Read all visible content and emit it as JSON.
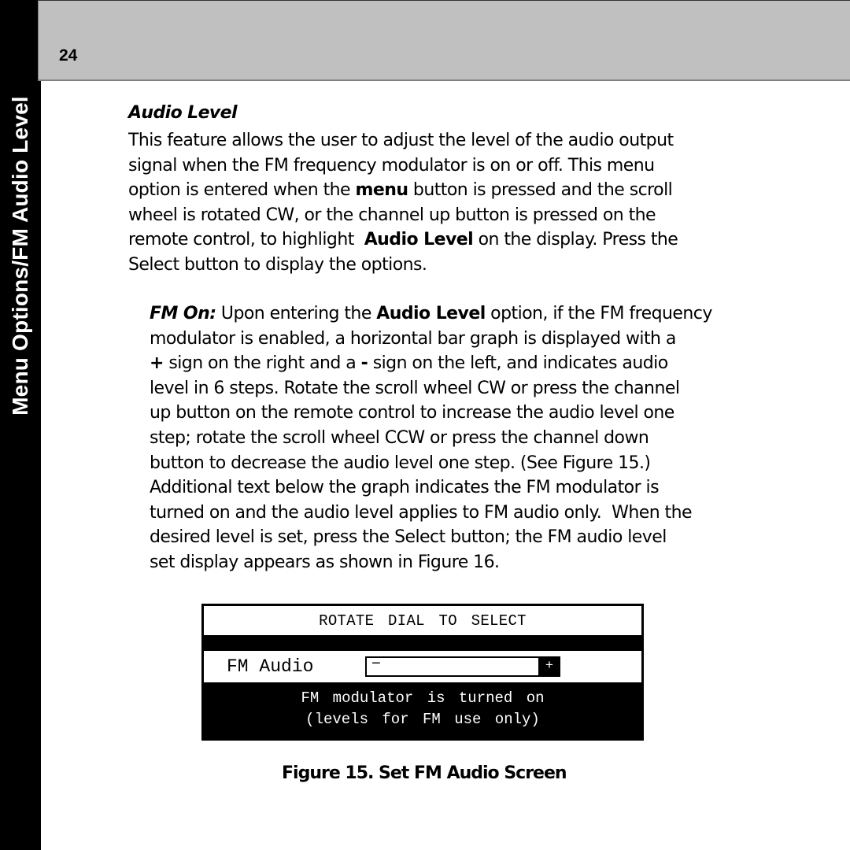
{
  "page": {
    "number": "24",
    "side_tab": "Menu Options/FM Audio Level"
  },
  "section": {
    "title": "Audio Level",
    "intro_lines": [
      [
        "This feature allows the user to adjust the level of the audio output"
      ],
      [
        "signal when the FM frequency modulator is on or off. This menu"
      ],
      [
        "option is entered when the ",
        {
          "b": "menu"
        },
        " button is pressed and the scroll"
      ],
      [
        "wheel is rotated CW, or the channel up button is pressed on the"
      ],
      [
        "remote control, to highlight  ",
        {
          "b": "Audio Level"
        },
        " on the display. Press the"
      ],
      [
        "Select button to display the options."
      ]
    ],
    "fm_on_lines": [
      [
        {
          "bi": "FM On:"
        },
        " Upon entering the ",
        {
          "b": "Audio Level"
        },
        " option, if the FM frequency"
      ],
      [
        "modulator is enabled, a horizontal bar graph is displayed with a"
      ],
      [
        {
          "b": "+"
        },
        " sign on the right and a ",
        {
          "b": "-"
        },
        " sign on the left, and indicates audio"
      ],
      [
        "level in 6 steps. Rotate the scroll wheel CW or press the channel"
      ],
      [
        "up button on the remote control to increase the audio level one"
      ],
      [
        "step; rotate the scroll wheel CCW or press the channel down"
      ],
      [
        "button to decrease the audio level one step. (See Figure 15.)"
      ],
      [
        "Additional text below the graph indicates the FM modulator is"
      ],
      [
        "turned on and the audio level applies to FM audio only.  When the"
      ],
      [
        "desired level is set, press the Select button; the FM audio level"
      ],
      [
        "set display appears as shown in Figure 16."
      ]
    ]
  },
  "lcd": {
    "header": "ROTATE DIAL TO SELECT",
    "label": "FM Audio",
    "minus": "−",
    "plus": "+",
    "level_steps_total": 6,
    "level_steps_filled": 0,
    "status_line1": "FM modulator is turned on",
    "status_line2": "(levels for FM use only)"
  },
  "figure": {
    "caption": "Figure 15. Set FM Audio Screen"
  }
}
